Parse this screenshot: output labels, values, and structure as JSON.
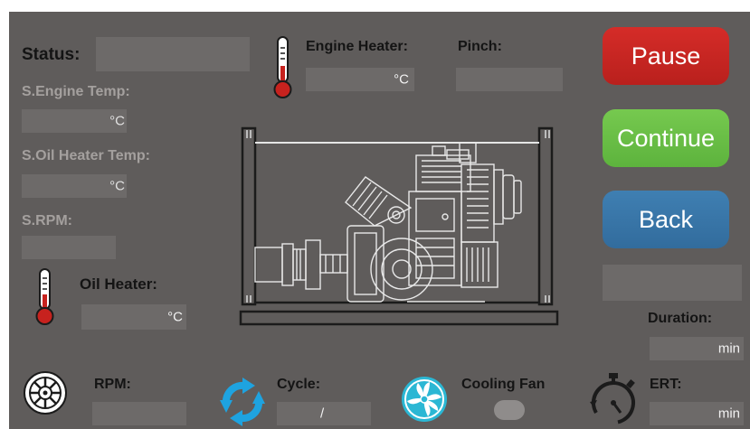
{
  "status": {
    "label": "Status:",
    "value": ""
  },
  "sensors": {
    "engine_temp": {
      "label": "S.Engine Temp:",
      "value": "",
      "unit": "°C"
    },
    "oil_heater_temp": {
      "label": "S.Oil Heater Temp:",
      "value": "",
      "unit": "°C"
    },
    "rpm": {
      "label": "S.RPM:",
      "value": ""
    }
  },
  "oil_heater": {
    "label": "Oil Heater:",
    "unit": "°C"
  },
  "engine_heater": {
    "label": "Engine Heater:",
    "unit": "°C"
  },
  "pinch": {
    "label": "Pinch:",
    "value": ""
  },
  "buttons": {
    "pause": "Pause",
    "continue": "Continue",
    "back": "Back"
  },
  "message": {
    "value": ""
  },
  "duration": {
    "label": "Duration:",
    "unit": "min"
  },
  "bottom": {
    "rpm": {
      "label": "RPM:",
      "value": ""
    },
    "cycle": {
      "label": "Cycle:",
      "value": "/"
    },
    "cooling_fan": {
      "label": "Cooling Fan"
    },
    "ert": {
      "label": "ERT:",
      "unit": "min"
    }
  },
  "colors": {
    "panel_bg": "#5f5c5b",
    "field_bg": "#6d6a69",
    "pause": "#c8231f",
    "continue": "#68be45",
    "back": "#3676a8",
    "cycle_icon": "#1ea3e0",
    "fan_icon": "#2bb7d4"
  },
  "icons": [
    "thermometer-icon",
    "engine-diagram",
    "wheel-icon",
    "cycle-icon",
    "fan-icon",
    "stopwatch-icon"
  ]
}
